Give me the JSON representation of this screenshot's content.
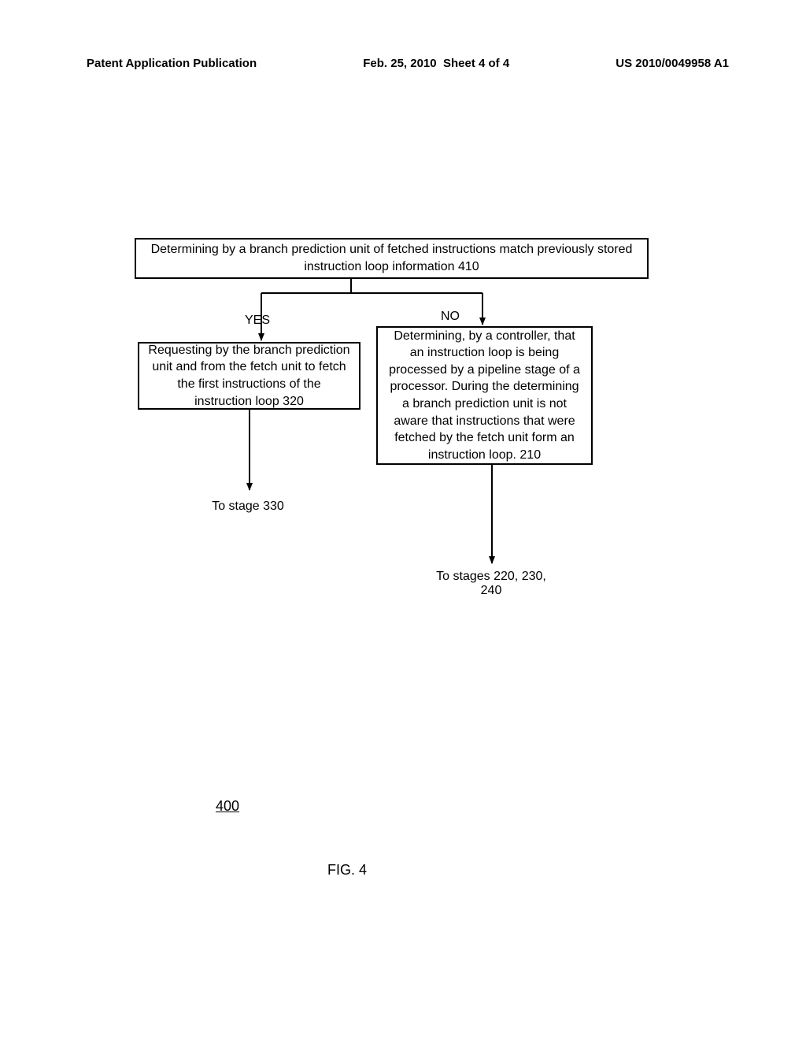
{
  "header": {
    "left": "Patent Application Publication",
    "center_date": "Feb. 25, 2010",
    "center_sheet": "Sheet 4 of 4",
    "right": "US 2010/0049958 A1"
  },
  "flow": {
    "box410": "Determining by a branch prediction unit of fetched instructions match previously stored instruction loop information 410",
    "label_yes": "YES",
    "label_no": "NO",
    "box320": "Requesting by the branch prediction unit and from the fetch unit to fetch the first instructions of the instruction loop 320",
    "box210": "Determining, by a controller, that an instruction loop is being processed by a pipeline stage of a processor. During the determining a branch prediction unit is not aware that instructions that were fetched by the fetch unit form an instruction loop. 210",
    "to330": "To stage 330",
    "to220": "To stages 220, 230, 240"
  },
  "figure_number": "400",
  "figure_caption": "FIG. 4"
}
